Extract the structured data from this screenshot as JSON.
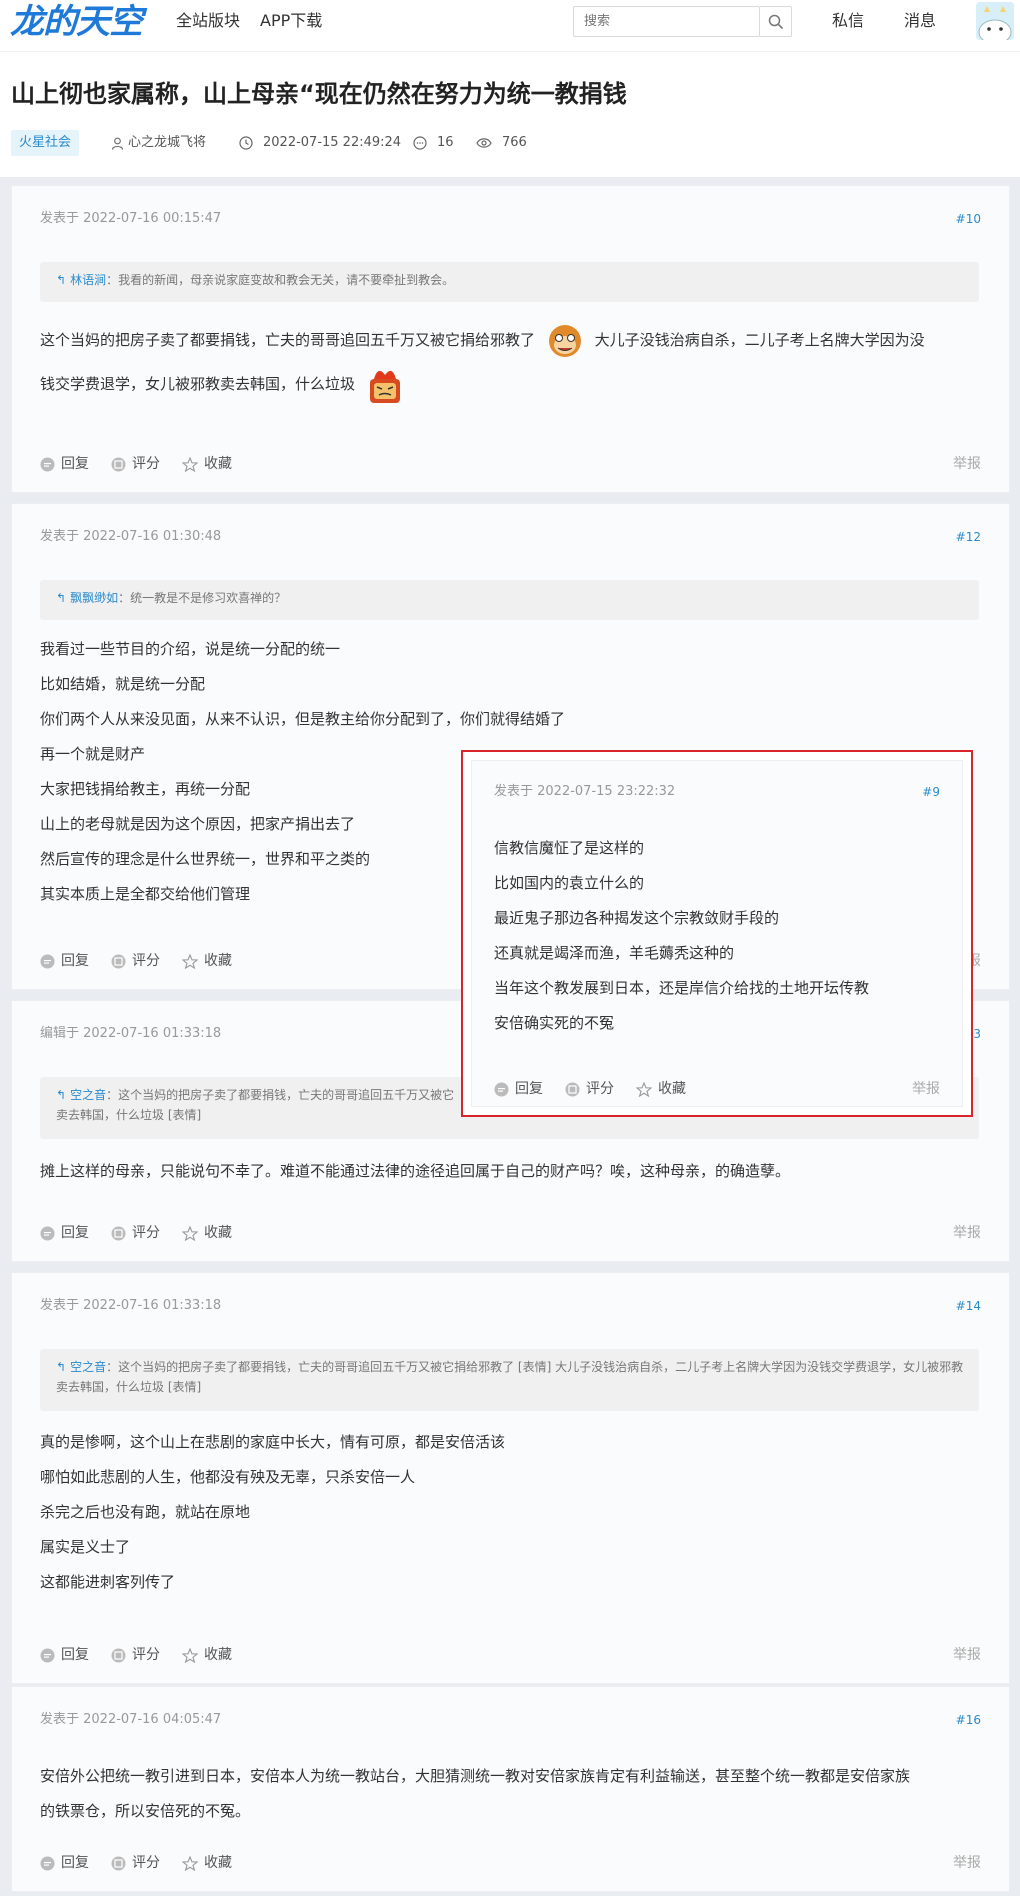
{
  "header": {
    "logo": "龙的天空",
    "nav": [
      "全站版块",
      "APP下载"
    ],
    "search_placeholder": "搜索",
    "messages": "私信",
    "notifications": "消息"
  },
  "thread": {
    "title": "山上彻也家属称，山上母亲“现在仍然在努力为统一教捐钱",
    "category": "火星社会",
    "author": "心之龙城飞将",
    "datetime": "2022-07-15 22:49:24",
    "replies": "16",
    "views": "766"
  },
  "actions": {
    "reply": "回复",
    "rate": "评分",
    "favorite": "收藏",
    "report": "举报"
  },
  "posts": [
    {
      "time": "发表于 2022-07-16 00:15:47",
      "floor": "#10",
      "quote_user": "林语涧",
      "quote_text": "：我看的新闻，母亲说家庭变故和教会无关，请不要牵扯到教会。",
      "line1a": "这个当妈的把房子卖了都要捐钱，亡夫的哥哥追回五千万又被它捐给邪教了",
      "line1b": "大儿子没钱治病自杀，二儿子考上名牌大学因为没",
      "line2": "钱交学费退学，女儿被邪教卖去韩国，什么垃圾"
    },
    {
      "time": "发表于 2022-07-16 01:30:48",
      "floor": "#12",
      "quote_user": "飘飘缈如",
      "quote_text": "：统一教是不是修习欢喜禅的？",
      "lines": [
        "我看过一些节目的介绍，说是统一分配的统一",
        "比如结婚，就是统一分配",
        "你们两个人从来没见面，从来不认识，但是教主给你分配到了，你们就得结婚了",
        "再一个就是财产",
        "大家把钱捐给教主，再统一分配",
        "山上的老母就是因为这个原因，把家产捐出去了",
        "然后宣传的理念是什么世界统一，世界和平之类的",
        "其实本质上是全都交给他们管理"
      ]
    },
    {
      "time": "编辑于 2022-07-16 01:33:18",
      "floor": "#13",
      "quote_user": "空之音",
      "quote_text": "：这个当妈的把房子卖了都要捐钱，亡夫的哥哥追回五千万又被它",
      "quote_text2": "卖去韩国，什么垃圾 [表情]",
      "text": "摊上这样的母亲，只能说句不幸了。难道不能通过法律的途径追回属于自己的财产吗？唉，这种母亲，的确造孽。"
    },
    {
      "time": "发表于 2022-07-16 01:33:18",
      "floor": "#14",
      "quote_user": "空之音",
      "quote_text": "：这个当妈的把房子卖了都要捐钱，亡夫的哥哥追回五千万又被它捐给邪教了 [表情] 大儿子没钱治病自杀，二儿子考上名牌大学因为没钱交学费退学，女儿被邪教",
      "quote_text2": "卖去韩国，什么垃圾 [表情]",
      "lines": [
        "真的是惨啊，这个山上在悲剧的家庭中长大，情有可原，都是安倍活该",
        "哪怕如此悲剧的人生，他都没有殃及无辜，只杀安倍一人",
        "杀完之后也没有跑，就站在原地",
        "属实是义士了",
        "这都能进刺客列传了"
      ]
    },
    {
      "time": "发表于 2022-07-16 04:05:47",
      "floor": "#16",
      "line1": "安倍外公把统一教引进到日本，安倍本人为统一教站台，大胆猜测统一教对安倍家族肯定有利益输送，甚至整个统一教都是安倍家族",
      "line2": "的铁票仓，所以安倍死的不冤。"
    }
  ],
  "popup": {
    "time": "发表于 2022-07-15 23:22:32",
    "floor": "#9",
    "lines": [
      "信教信魔怔了是这样的",
      "比如国内的袁立什么的",
      "最近鬼子那边各种揭发这个宗教敛财手段的",
      "还真就是竭泽而渔，羊毛薅秃这种的",
      "当年这个教发展到日本，还是岸信介给找的土地开坛传教",
      "安倍确实死的不冤"
    ]
  }
}
